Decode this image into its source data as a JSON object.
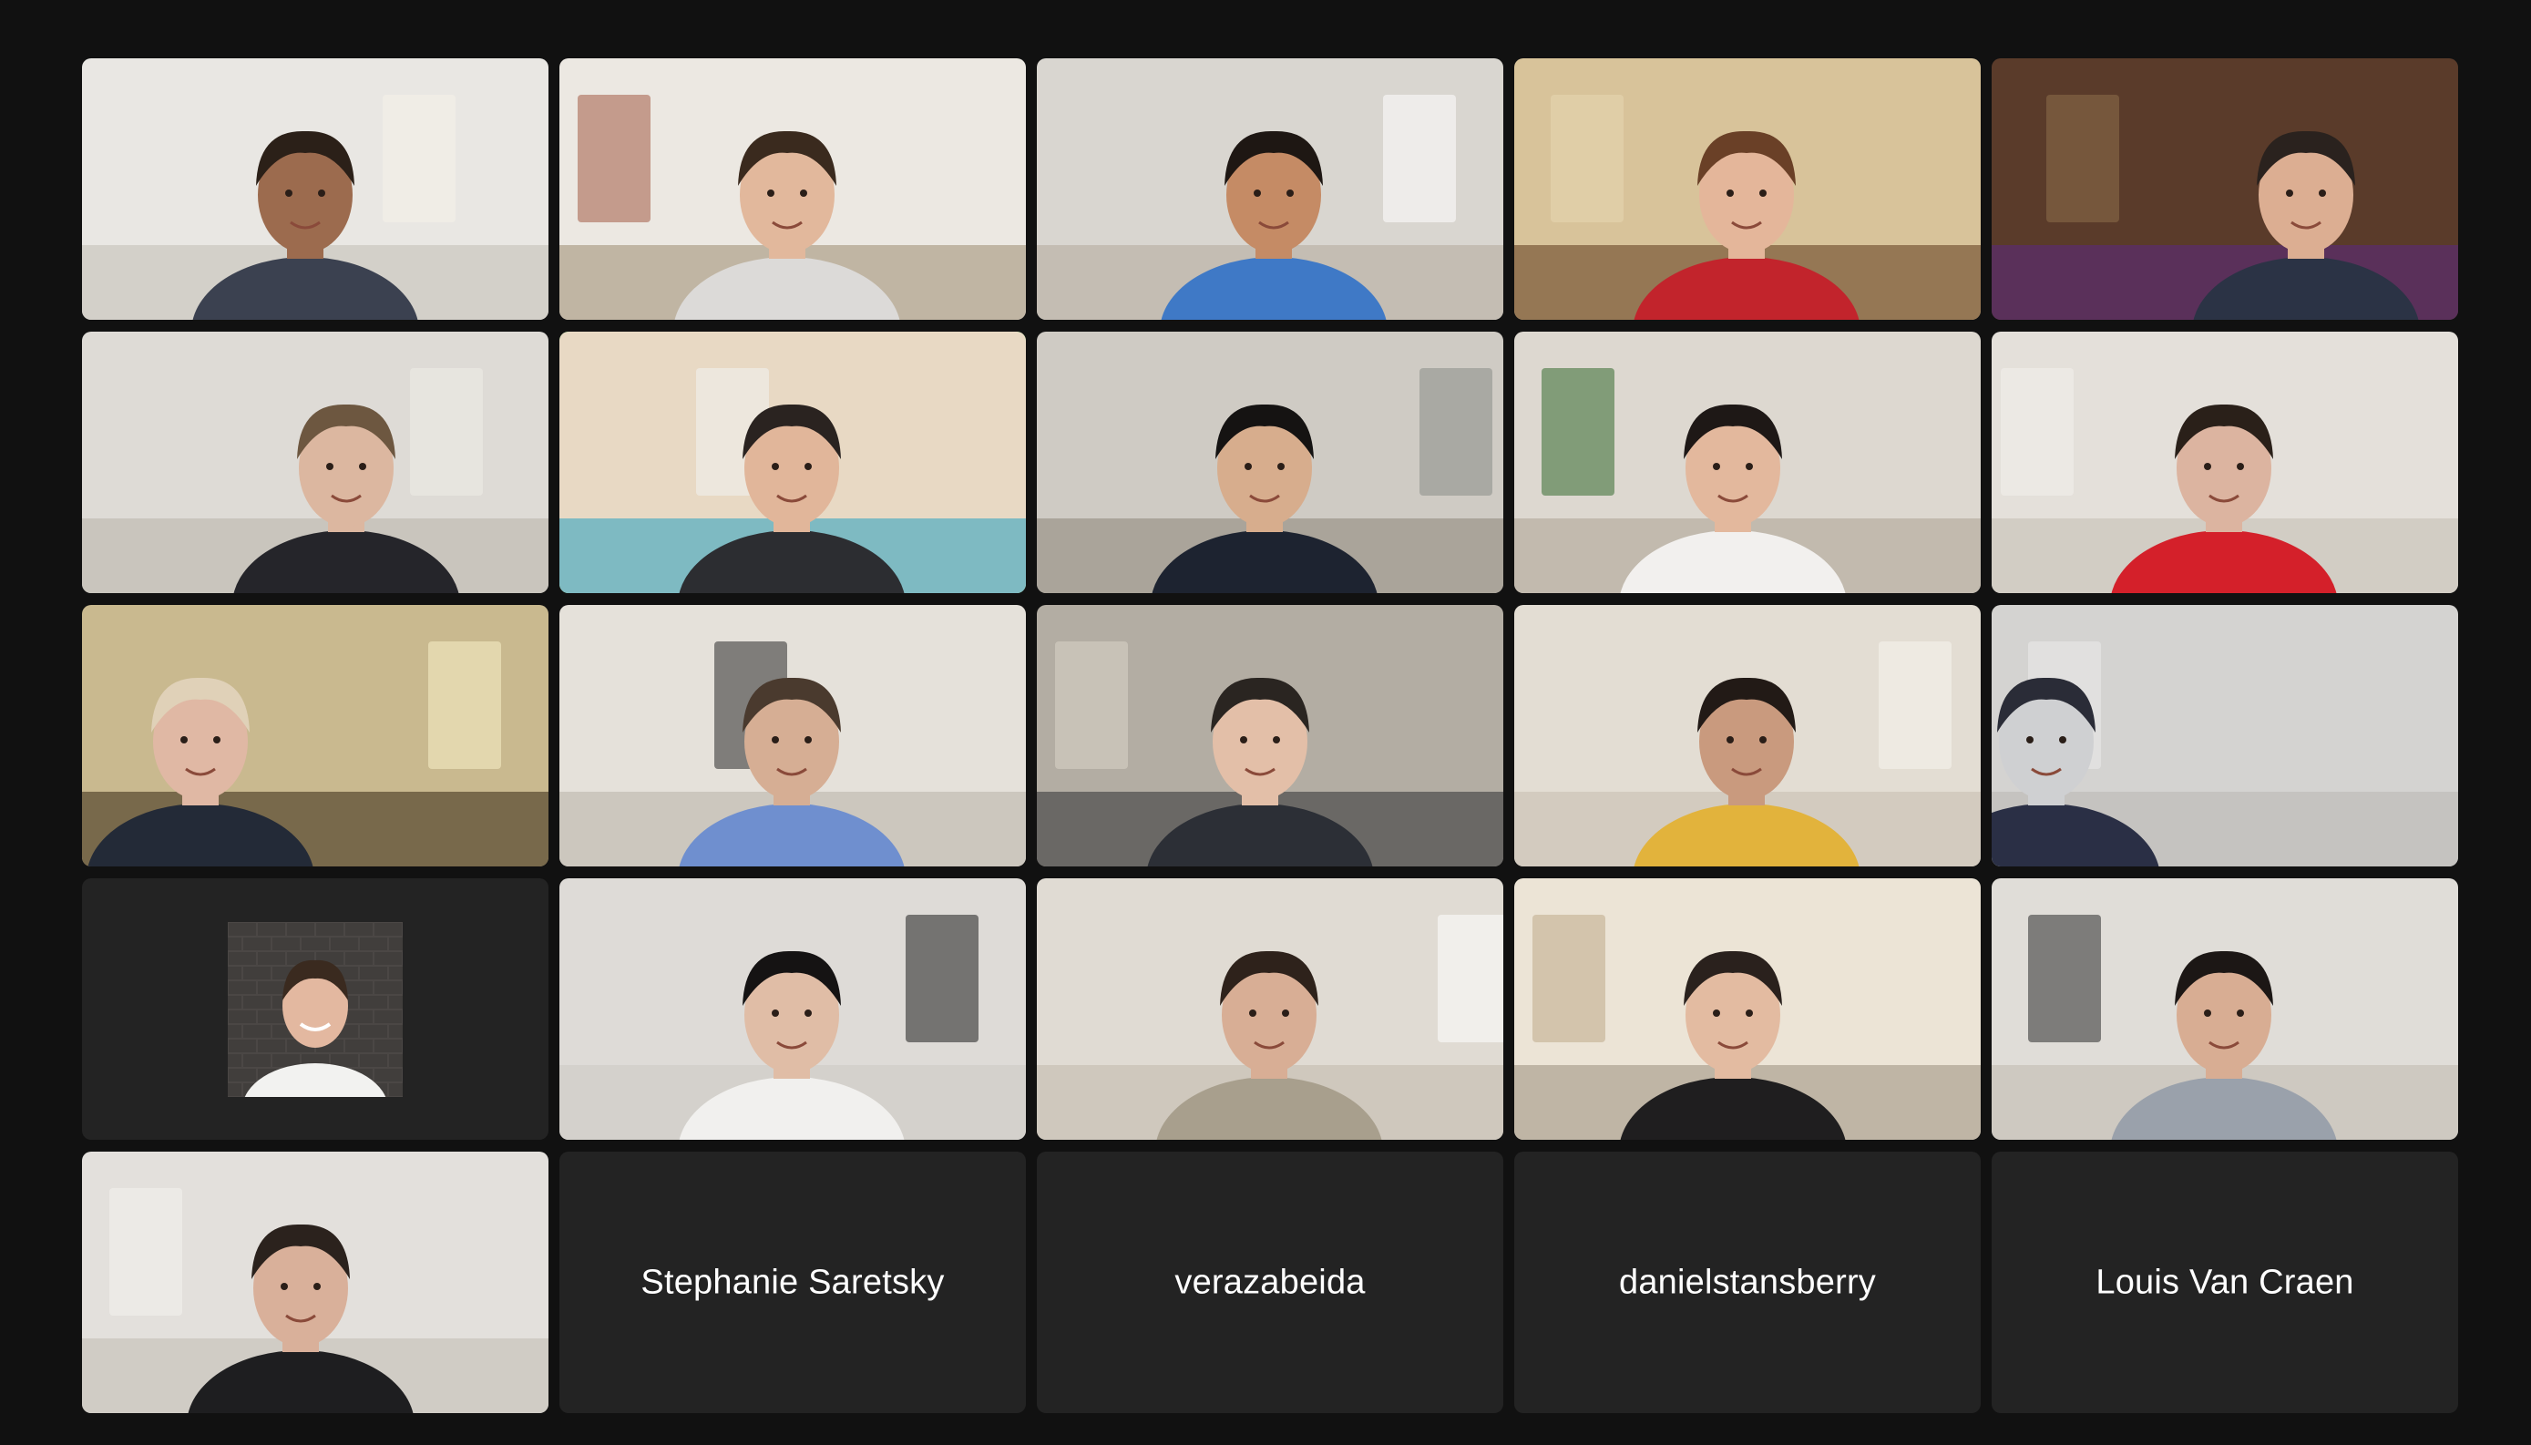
{
  "app": "Video meeting gallery view",
  "grid": {
    "columns": 5,
    "rows": 5
  },
  "participants": [
    {
      "id": "p1",
      "kind": "video",
      "wall": "#e9e7e3",
      "floor": "#cfcbc4",
      "skin": "#9c6b4e",
      "hair": "#2b2018",
      "shirt": "#3b4150",
      "accent": "#f6f3ea"
    },
    {
      "id": "p2",
      "kind": "video",
      "wall": "#ece8e2",
      "floor": "#b8ab98",
      "skin": "#e2b89c",
      "hair": "#3a2a1e",
      "shirt": "#dcdad8",
      "accent": "#a45b45"
    },
    {
      "id": "p3",
      "kind": "video",
      "wall": "#d9d6d0",
      "floor": "#bfb9ae",
      "skin": "#c58b65",
      "hair": "#1e1713",
      "shirt": "#3f79c6",
      "accent": "#ffffff"
    },
    {
      "id": "p4",
      "kind": "video",
      "wall": "#d8c39a",
      "floor": "#8a6a48",
      "skin": "#e4b69a",
      "hair": "#6a4027",
      "shirt": "#c2242c",
      "accent": "#e7d7b2"
    },
    {
      "id": "p5",
      "kind": "video",
      "wall": "#5a3b2a",
      "floor": "#5b2f63",
      "skin": "#dcae92",
      "hair": "#2a221e",
      "shirt": "#2b3345",
      "accent": "#8e6f4b"
    },
    {
      "id": "p6",
      "kind": "video",
      "wall": "#dedbd6",
      "floor": "#c6c1b9",
      "skin": "#dcb7a0",
      "hair": "#6d5740",
      "shirt": "#25252a",
      "accent": "#efece7"
    },
    {
      "id": "p7",
      "kind": "video",
      "wall": "#e8d9c4",
      "floor": "#6bb4c2",
      "skin": "#e1b69a",
      "hair": "#2a2320",
      "shirt": "#2c2d31",
      "accent": "#f1f2f2"
    },
    {
      "id": "p8",
      "kind": "video",
      "wall": "#cfcbc4",
      "floor": "#a39d93",
      "skin": "#d7ad8d",
      "hair": "#151312",
      "shirt": "#1d2330",
      "accent": "#8a8e89"
    },
    {
      "id": "p9",
      "kind": "video",
      "wall": "#ddd8d0",
      "floor": "#bdb5a8",
      "skin": "#e3b89d",
      "hair": "#1e1816",
      "shirt": "#f2f0ee",
      "accent": "#356b2f"
    },
    {
      "id": "p10",
      "kind": "video",
      "wall": "#e4e0da",
      "floor": "#cfc9c0",
      "skin": "#dcb4a0",
      "hair": "#2a2019",
      "shirt": "#d4202a",
      "accent": "#f3f1ec"
    },
    {
      "id": "p11",
      "kind": "video",
      "wall": "#c9b98f",
      "floor": "#6a5b3f",
      "skin": "#e0b8a4",
      "hair": "#e0d1b8",
      "shirt": "#232a37",
      "accent": "#f7f0c8"
    },
    {
      "id": "p12",
      "kind": "video",
      "wall": "#e5e1da",
      "floor": "#c8c2b8",
      "skin": "#d6ae94",
      "hair": "#4a3a2e",
      "shirt": "#6f8fcf",
      "accent": "#2b2b2b"
    },
    {
      "id": "p13",
      "kind": "video",
      "wall": "#b3ada3",
      "floor": "#5d5c5a",
      "skin": "#e3bfa8",
      "hair": "#2a2521",
      "shirt": "#2c2f36",
      "accent": "#d8d3c8"
    },
    {
      "id": "p14",
      "kind": "video",
      "wall": "#e3ddd3",
      "floor": "#d0c8bb",
      "skin": "#c99a7e",
      "hair": "#221a16",
      "shirt": "#e2b33c",
      "accent": "#f7f4ee"
    },
    {
      "id": "p15",
      "kind": "video",
      "wall": "#d4d3d1",
      "floor": "#c2c0bd",
      "skin": "#cfd0d2",
      "hair": "#2a2c37",
      "shirt": "#2a2f45",
      "accent": "#ebebeb"
    },
    {
      "id": "p16",
      "kind": "photo",
      "wall": "#4b4745",
      "floor": "#ffffff",
      "skin": "#e3b8a0",
      "hair": "#3a2a1f",
      "shirt": "#f2f2f0",
      "accent": "#3a3634"
    },
    {
      "id": "p17",
      "kind": "video",
      "wall": "#dedbd7",
      "floor": "#d2cfca",
      "skin": "#e0bda6",
      "hair": "#151313",
      "shirt": "#f1f0ee",
      "accent": "#1d1d1d"
    },
    {
      "id": "p18",
      "kind": "video",
      "wall": "#e0dbd3",
      "floor": "#cbc4b8",
      "skin": "#d8ae95",
      "hair": "#2e221b",
      "shirt": "#a89f8d",
      "accent": "#ffffff"
    },
    {
      "id": "p19",
      "kind": "video",
      "wall": "#ece4d6",
      "floor": "#b7ad9c",
      "skin": "#e3bba1",
      "hair": "#2a211d",
      "shirt": "#1f1e1f",
      "accent": "#bfa98a"
    },
    {
      "id": "p20",
      "kind": "video",
      "wall": "#e0ddd8",
      "floor": "#cac5bd",
      "skin": "#d8ad93",
      "hair": "#1c1715",
      "shirt": "#9aa1ab",
      "accent": "#2b2b2e"
    },
    {
      "id": "p21",
      "kind": "video",
      "wall": "#e3e0dc",
      "floor": "#cdc8c1",
      "skin": "#d9b09a",
      "hair": "#2b221d",
      "shirt": "#1e1e20",
      "accent": "#f4f2ef"
    },
    {
      "id": "p22",
      "kind": "name",
      "name": "Stephanie Saretsky"
    },
    {
      "id": "p23",
      "kind": "name",
      "name": "verazabeida"
    },
    {
      "id": "p24",
      "kind": "name",
      "name": "danielstansberry"
    },
    {
      "id": "p25",
      "kind": "name",
      "name": "Louis Van Craen"
    }
  ],
  "active_speaker": "p7",
  "colors": {
    "background": "#111111",
    "tile": "#232323",
    "speaker_highlight": "#3fd24f",
    "name_text": "#ffffff"
  }
}
